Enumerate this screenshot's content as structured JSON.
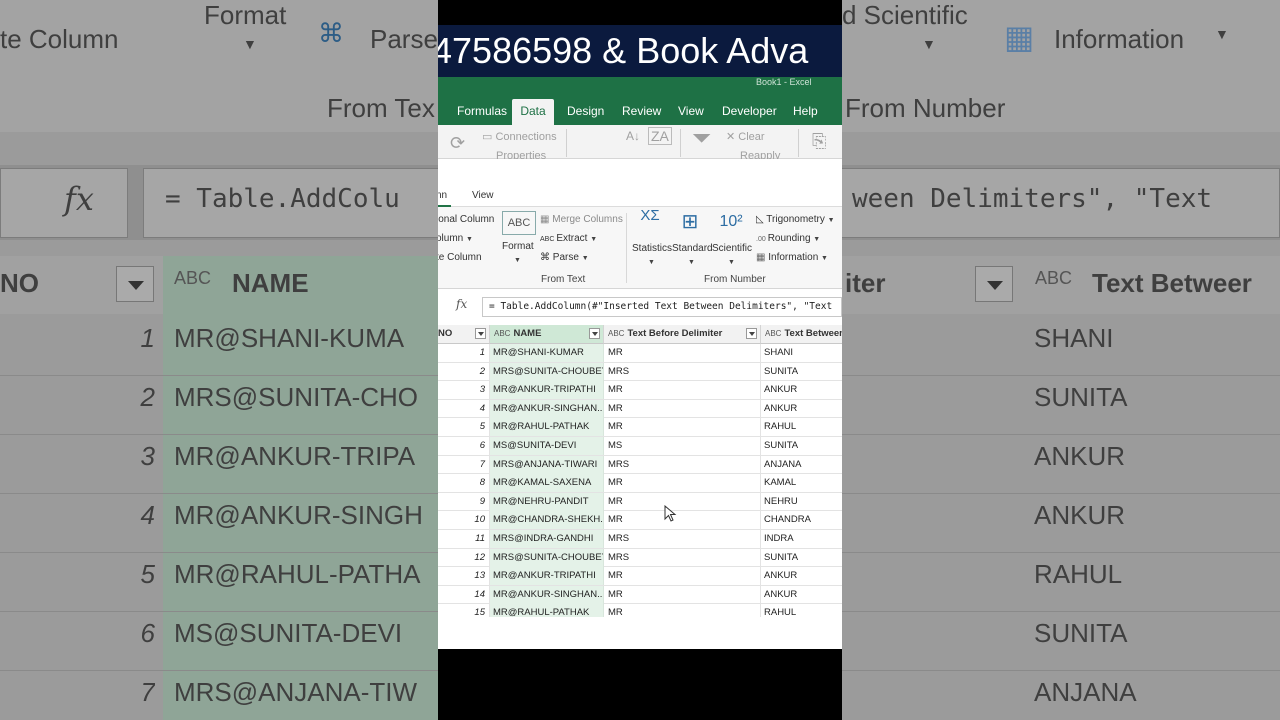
{
  "banner": {
    "text": "47586598 & Book Adva"
  },
  "excel": {
    "mini_title": "Book1 - Excel",
    "tabs": [
      "Formulas",
      "Data",
      "Design",
      "Review",
      "View",
      "Developer",
      "Help"
    ],
    "active_tab": "Data",
    "data_ribbon": {
      "connections": "Connections",
      "properties": "Properties",
      "clear": "Clear",
      "reapply": "Reapply"
    }
  },
  "pq": {
    "tabs": [
      "nn",
      "View"
    ],
    "ribbon": {
      "conditional_column": "ional Column",
      "column_from": "olumn",
      "duplicate_column": "te Column",
      "format": "Format",
      "merge_columns": "Merge Columns",
      "extract": "Extract",
      "parse": "Parse",
      "group_from_text": "From Text",
      "statistics": "Statistics",
      "standard": "Standard",
      "scientific": "Scientific",
      "trigonometry": "Trigonometry",
      "rounding": "Rounding",
      "information": "Information",
      "group_from_number": "From Number",
      "scientific_glyph": "10²"
    },
    "formula": "= Table.AddColumn(#\"Inserted Text Between Delimiters\", \"Text",
    "columns": {
      "no": "NO",
      "name": "NAME",
      "before": "Text Before Delimiter",
      "between": "Text Between",
      "type_icon": "ABC"
    },
    "rows": [
      {
        "no": "1",
        "name": "MR@SHANI-KUMAR",
        "before": "MR",
        "between": "SHANI"
      },
      {
        "no": "2",
        "name": "MRS@SUNITA-CHOUBEY",
        "before": "MRS",
        "between": "SUNITA"
      },
      {
        "no": "3",
        "name": "MR@ANKUR-TRIPATHI",
        "before": "MR",
        "between": "ANKUR"
      },
      {
        "no": "4",
        "name": "MR@ANKUR-SINGHAN...",
        "before": "MR",
        "between": "ANKUR"
      },
      {
        "no": "5",
        "name": "MR@RAHUL-PATHAK",
        "before": "MR",
        "between": "RAHUL"
      },
      {
        "no": "6",
        "name": "MS@SUNITA-DEVI",
        "before": "MS",
        "between": "SUNITA"
      },
      {
        "no": "7",
        "name": "MRS@ANJANA-TIWARI",
        "before": "MRS",
        "between": "ANJANA"
      },
      {
        "no": "8",
        "name": "MR@KAMAL-SAXENA",
        "before": "MR",
        "between": "KAMAL"
      },
      {
        "no": "9",
        "name": "MR@NEHRU-PANDIT",
        "before": "MR",
        "between": "NEHRU"
      },
      {
        "no": "10",
        "name": "MR@CHANDRA-SHEKH...",
        "before": "MR",
        "between": "CHANDRA"
      },
      {
        "no": "11",
        "name": "MRS@INDRA-GANDHI",
        "before": "MRS",
        "between": "INDRA"
      },
      {
        "no": "12",
        "name": "MRS@SUNITA-CHOUBEY",
        "before": "MRS",
        "between": "SUNITA"
      },
      {
        "no": "13",
        "name": "MR@ANKUR-TRIPATHI",
        "before": "MR",
        "between": "ANKUR"
      },
      {
        "no": "14",
        "name": "MR@ANKUR-SINGHAN...",
        "before": "MR",
        "between": "ANKUR"
      },
      {
        "no": "15",
        "name": "MR@RAHUL-PATHAK",
        "before": "MR",
        "between": "RAHUL"
      }
    ]
  },
  "bg": {
    "format": "Format",
    "parse": "Parse",
    "scientific": "d Scientific",
    "information": "Information",
    "duplicate_column": "te Column",
    "from_text": "From Tex",
    "from_number": "From Number",
    "fx": "fx",
    "formula": "= Table.AddColu",
    "formula_right": "ween Delimiters\", \"Text",
    "col_no": "NO",
    "col_name": "NAME",
    "col_iter": "iter",
    "col_between": "Text Betweer",
    "type_icon": "ABC",
    "rows": [
      {
        "no": "1",
        "name": "MR@SHANI-KUMA",
        "between": "SHANI"
      },
      {
        "no": "2",
        "name": "MRS@SUNITA-CHO",
        "between": "SUNITA"
      },
      {
        "no": "3",
        "name": "MR@ANKUR-TRIPA",
        "between": "ANKUR"
      },
      {
        "no": "4",
        "name": "MR@ANKUR-SINGH",
        "between": "ANKUR"
      },
      {
        "no": "5",
        "name": "MR@RAHUL-PATHA",
        "between": "RAHUL"
      },
      {
        "no": "6",
        "name": "MS@SUNITA-DEVI",
        "between": "SUNITA"
      },
      {
        "no": "7",
        "name": "MRS@ANJANA-TIW",
        "between": "ANJANA"
      }
    ]
  }
}
